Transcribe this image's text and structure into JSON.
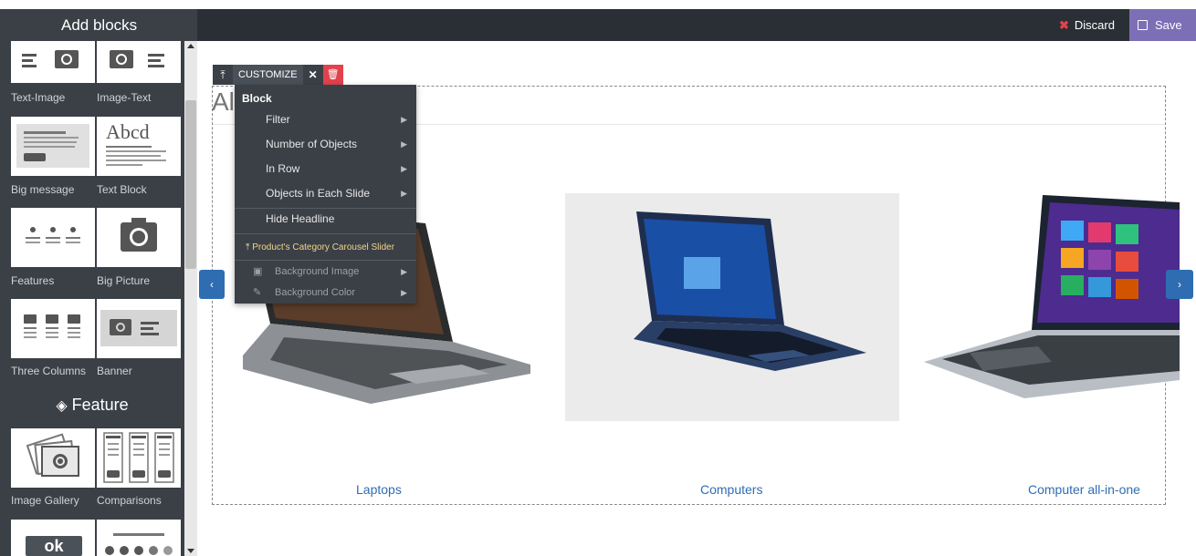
{
  "sidebar": {
    "title": "Add blocks",
    "feature_heading": "Feature",
    "tiles": [
      {
        "label": "Text-Image"
      },
      {
        "label": "Image-Text"
      },
      {
        "label": "Big message"
      },
      {
        "label": "Text Block",
        "preview_text": "Abcd"
      },
      {
        "label": "Features"
      },
      {
        "label": "Big Picture"
      },
      {
        "label": "Three Columns"
      },
      {
        "label": "Banner"
      },
      {
        "label": "Image Gallery"
      },
      {
        "label": "Comparisons"
      },
      {
        "preview_text": "ok"
      }
    ]
  },
  "header": {
    "discard_label": "Discard",
    "save_label": "Save"
  },
  "toolbar": {
    "move_glyph": "⤒",
    "customize_label": "CUSTOMIZE",
    "close_glyph": "✕",
    "delete_glyph": "🗑"
  },
  "menu": {
    "heading": "Block",
    "items": [
      {
        "label": "Filter"
      },
      {
        "label": "Number of Objects"
      },
      {
        "label": "In Row"
      },
      {
        "label": "Objects in Each Slide"
      },
      {
        "label": "Hide Headline"
      }
    ],
    "subheading": "Product's Category Carousel Slider",
    "dim_items": [
      {
        "label": "Background Image"
      },
      {
        "label": "Background Color"
      }
    ]
  },
  "canvas": {
    "headline": "Al",
    "products": [
      {
        "label": "Laptops"
      },
      {
        "label": "Computers"
      },
      {
        "label": "Computer all-in-one"
      }
    ]
  },
  "colors": {
    "navbar": "#2a2f35",
    "sidebar": "#3b4047",
    "save": "#7c6fb5",
    "discard_x": "#e2424d",
    "accent_blue": "#2f6db2"
  }
}
